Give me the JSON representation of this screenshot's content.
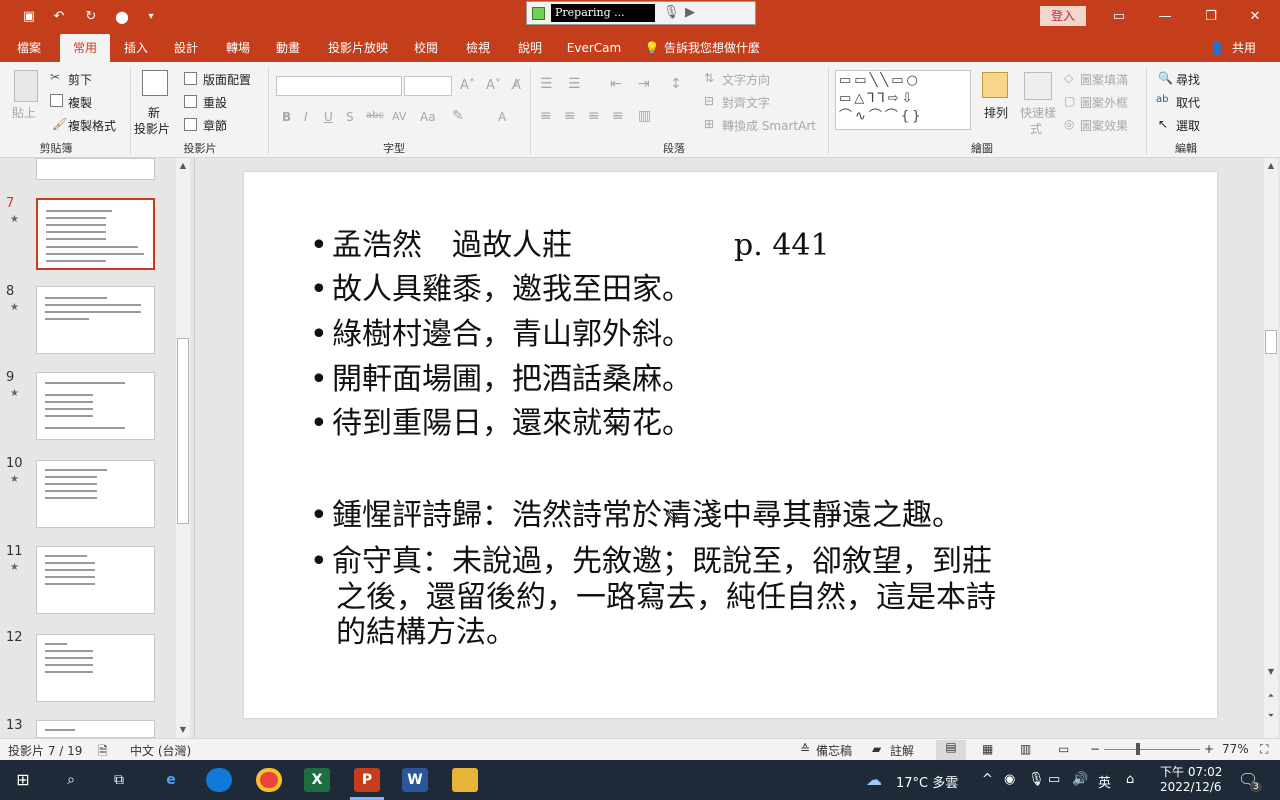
{
  "titlebar": {
    "recorder_status": "Preparing ...",
    "signin": "登入"
  },
  "tabs": [
    "檔案",
    "常用",
    "插入",
    "設計",
    "轉場",
    "動畫",
    "投影片放映",
    "校閱",
    "檢視",
    "說明",
    "EverCam"
  ],
  "active_tab": "常用",
  "tell_me": "告訴我您想做什麼",
  "share": "共用",
  "ribbon": {
    "clipboard": {
      "paste": "貼上",
      "cut": "剪下",
      "copy": "複製",
      "format_painter": "複製格式",
      "label": "剪貼簿"
    },
    "slides": {
      "new_line1": "新",
      "new_line2": "投影片",
      "layout": "版面配置",
      "reset": "重設",
      "section": "章節",
      "label": "投影片"
    },
    "font": {
      "label": "字型"
    },
    "paragraph": {
      "text_direction": "文字方向",
      "align_text": "對齊文字",
      "smartart": "轉換成 SmartArt",
      "label": "段落"
    },
    "drawing": {
      "arrange": "排列",
      "quick_styles_1": "快速樣",
      "quick_styles_2": "式",
      "shape_fill": "圖案填滿",
      "shape_outline": "圖案外框",
      "shape_effects": "圖案效果",
      "label": "繪圖"
    },
    "editing": {
      "find": "尋找",
      "replace": "取代",
      "select": "選取",
      "label": "編輯"
    }
  },
  "thumbnails": [
    {
      "num": "7",
      "star": "★"
    },
    {
      "num": "8",
      "star": "★"
    },
    {
      "num": "9",
      "star": "★"
    },
    {
      "num": "10",
      "star": "★"
    },
    {
      "num": "11",
      "star": "★"
    },
    {
      "num": "12",
      "star": ""
    },
    {
      "num": "13",
      "star": ""
    }
  ],
  "slide": {
    "title_line": "孟浩然　過故人莊",
    "page_ref": "p. 441",
    "lines": [
      "故人具雞黍，邀我至田家。",
      "綠樹村邊合，青山郭外斜。",
      "開軒面場圃，把酒話桑麻。",
      "待到重陽日，還來就菊花。"
    ],
    "comment1": "鍾惺評詩歸：浩然詩常於清淺中尋其靜遠之趣。",
    "comment2_l1": "俞守真：未說過，先敘邀；既說至，卻敘望，到莊",
    "comment2_l2": "之後，還留後約，一路寫去，純任自然，這是本詩",
    "comment2_l3": "的結構方法。"
  },
  "status": {
    "slide_info": "投影片 7 / 19",
    "language": "中文 (台灣)",
    "notes": "備忘稿",
    "comments": "註解",
    "zoom": "77%"
  },
  "taskbar": {
    "weather": "17°C  多雲",
    "ime": "英",
    "time": "下午 07:02",
    "date": "2022/12/6",
    "notif": "3"
  }
}
